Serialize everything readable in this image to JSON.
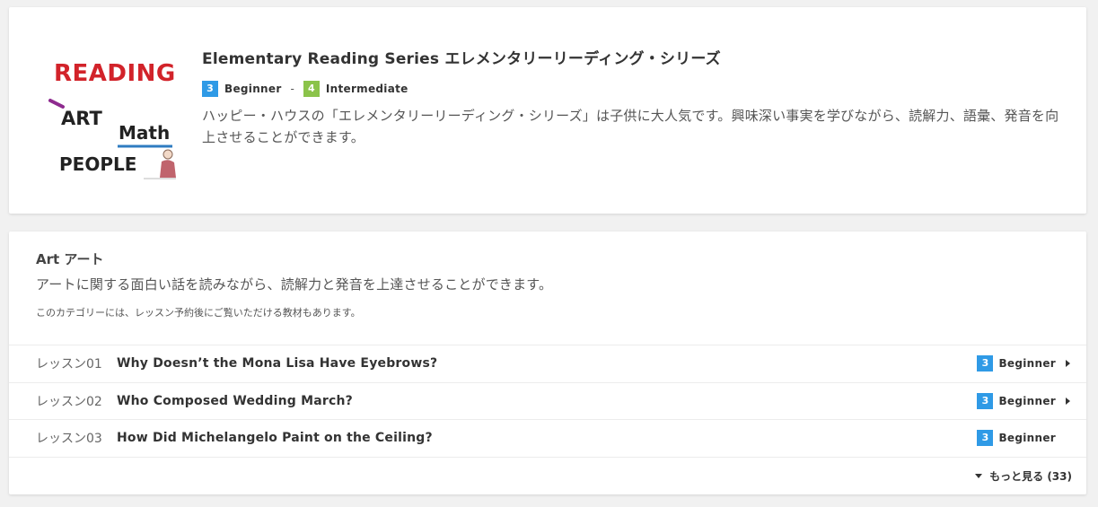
{
  "colors": {
    "beginner": "#2f9ae6",
    "intermediate": "#8bc34a"
  },
  "series": {
    "logo_words": [
      "READING",
      "ART",
      "Math",
      "PEOPLE"
    ],
    "title": "Elementary Reading Series エレメンタリーリーディング・シリーズ",
    "level_from": {
      "num": "3",
      "label": "Beginner"
    },
    "level_separator": "-",
    "level_to": {
      "num": "4",
      "label": "Intermediate"
    },
    "description": "ハッピー・ハウスの「エレメンタリーリーディング・シリーズ」は子供に大人気です。興味深い事実を学びながら、読解力、語彙、発音を向上させることができます。"
  },
  "category": {
    "title": "Art アート",
    "description": "アートに関する面白い話を読みながら、読解力と発音を上達させることができます。",
    "note": "このカテゴリーには、レッスン予約後にご覧いただける教材もあります。",
    "lessons": [
      {
        "num": "レッスン01",
        "title": "Why Doesn’t the Mona Lisa Have Eyebrows?",
        "level_num": "3",
        "level_label": "Beginner",
        "has_arrow": true
      },
      {
        "num": "レッスン02",
        "title": "Who Composed Wedding March?",
        "level_num": "3",
        "level_label": "Beginner",
        "has_arrow": true
      },
      {
        "num": "レッスン03",
        "title": "How Did Michelangelo Paint on the Ceiling?",
        "level_num": "3",
        "level_label": "Beginner",
        "has_arrow": false
      }
    ],
    "more_label": "もっと見る (33)"
  }
}
